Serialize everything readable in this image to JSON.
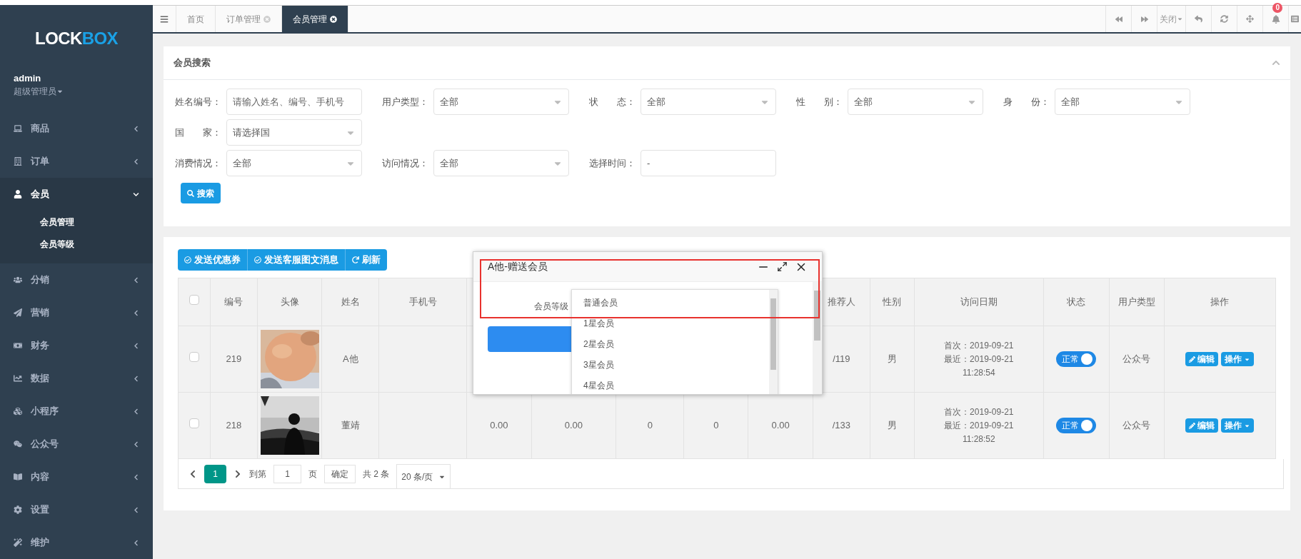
{
  "sidebar": {
    "logo": {
      "dark_part": "LOCK",
      "blue_part": "BOX"
    },
    "user": {
      "name": "admin",
      "role": "超级管理员"
    },
    "items": [
      {
        "label": "商品",
        "expanded": false
      },
      {
        "label": "订单",
        "expanded": false
      },
      {
        "label": "会员",
        "expanded": true,
        "children": [
          {
            "label": "会员管理"
          },
          {
            "label": "会员等级"
          }
        ]
      },
      {
        "label": "分销",
        "expanded": false
      },
      {
        "label": "营销",
        "expanded": false
      },
      {
        "label": "财务",
        "expanded": false
      },
      {
        "label": "数据",
        "expanded": false
      },
      {
        "label": "小程序",
        "expanded": false
      },
      {
        "label": "公众号",
        "expanded": false
      },
      {
        "label": "内容",
        "expanded": false
      },
      {
        "label": "设置",
        "expanded": false
      },
      {
        "label": "维护",
        "expanded": false
      }
    ]
  },
  "tabs": [
    {
      "label": "首页",
      "selected": false,
      "closable": false
    },
    {
      "label": "订单管理",
      "selected": false,
      "closable": true
    },
    {
      "label": "会员管理",
      "selected": true,
      "closable": true
    }
  ],
  "toolbar": {
    "close_menu": "关闭",
    "notification_count": "0"
  },
  "search": {
    "title": "会员搜索",
    "rows": [
      [
        {
          "label": "姓名编号：",
          "kind": "text",
          "placeholder": "请输入姓名、编号、手机号"
        },
        {
          "label": "用户类型：",
          "kind": "select",
          "value": "全部"
        },
        {
          "label": "状　　态：",
          "kind": "select",
          "value": "全部"
        },
        {
          "label": "性　　别：",
          "kind": "select",
          "value": "全部"
        },
        {
          "label": "身　　份：",
          "kind": "select",
          "value": "全部"
        }
      ],
      [
        {
          "label": "国　　家：",
          "kind": "select",
          "value": "请选择国"
        }
      ],
      [
        {
          "label": "消费情况：",
          "kind": "select",
          "value": "全部"
        },
        {
          "label": "访问情况：",
          "kind": "select",
          "value": "全部"
        },
        {
          "label": "选择时间：",
          "kind": "text",
          "value": "-"
        }
      ]
    ],
    "button": "搜索"
  },
  "actions": [
    "发送优惠券",
    "发送客服图文消息",
    "刷新"
  ],
  "table": {
    "columns": [
      {
        "label": "编号"
      },
      {
        "label": "头像"
      },
      {
        "label": "姓名"
      },
      {
        "label": "手机号"
      },
      {},
      {},
      {},
      {},
      {},
      {
        "label": "推荐人"
      },
      {
        "label": "性别"
      },
      {
        "label": "访问日期"
      },
      {
        "label": "状态"
      },
      {
        "label": "用户类型"
      },
      {
        "label": "操作"
      }
    ],
    "all_checked": false,
    "rows": [
      {
        "checked": false,
        "id": "219",
        "name": "A他",
        "referrer": "/119",
        "gender": "男",
        "visit": [
          "首次：2019-09-21",
          "最近：2019-09-21",
          "11:28:54"
        ],
        "status": {
          "label": "正常",
          "on": true
        },
        "user_type": "公众号",
        "edit": "编辑",
        "more": "操作"
      },
      {
        "checked": false,
        "id": "218",
        "name": "董靖",
        "values": [
          "0.00",
          "0.00",
          "0",
          "0",
          "0.00"
        ],
        "referrer": "/133",
        "gender": "男",
        "visit": [
          "首次：2019-09-21",
          "最近：2019-09-21",
          "11:28:52"
        ],
        "status": {
          "label": "正常",
          "on": true
        },
        "user_type": "公众号",
        "edit": "编辑",
        "more": "操作"
      }
    ]
  },
  "pagination": {
    "pages": [
      {
        "label": "1",
        "selected": true
      }
    ],
    "goto_label": "到第",
    "goto_value": "1",
    "page_unit": "页",
    "confirm": "确定",
    "total": "共 2 条",
    "page_size": "20 条/页"
  },
  "dialog": {
    "title": "A他-赠送会员",
    "field_label": "会员等级",
    "options": [
      "普通会员",
      "1星会员",
      "2星会员",
      "3星会员",
      "4星会员"
    ]
  }
}
